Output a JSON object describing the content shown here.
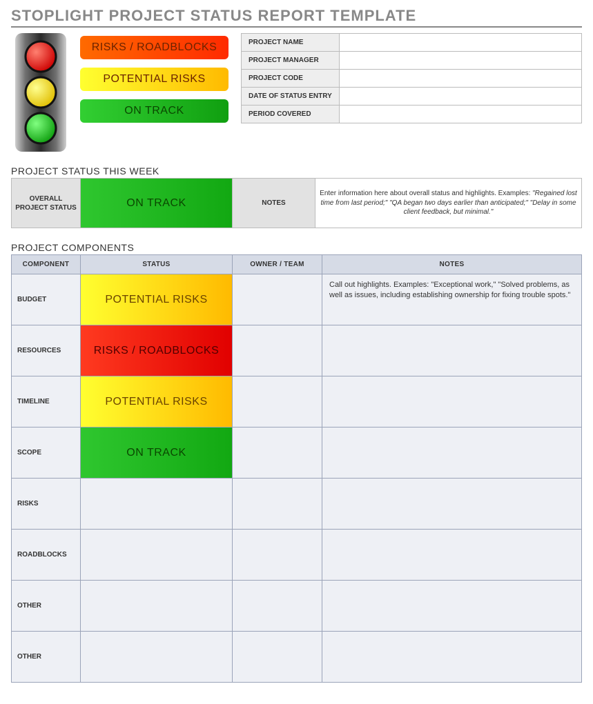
{
  "title": "STOPLIGHT PROJECT STATUS REPORT TEMPLATE",
  "legend": {
    "red": "RISKS / ROADBLOCKS",
    "yellow": "POTENTIAL RISKS",
    "green": "ON TRACK"
  },
  "meta_fields": {
    "project_name": {
      "label": "PROJECT NAME",
      "value": ""
    },
    "project_manager": {
      "label": "PROJECT MANAGER",
      "value": ""
    },
    "project_code": {
      "label": "PROJECT CODE",
      "value": ""
    },
    "date_of_status_entry": {
      "label": "DATE OF STATUS ENTRY",
      "value": ""
    },
    "period_covered": {
      "label": "PERIOD COVERED",
      "value": ""
    }
  },
  "week_section_title": "PROJECT STATUS THIS WEEK",
  "week": {
    "overall_caption": "OVERALL PROJECT STATUS",
    "overall_status_text": "ON TRACK",
    "overall_status_color": "green",
    "notes_caption": "NOTES",
    "notes_lead": "Enter information here about overall status and highlights. Examples: ",
    "notes_examples": "\"Regained lost time from last period;\" \"QA began two days earlier than anticipated;\" \"Delay in some client feedback, but minimal.\""
  },
  "components_section_title": "PROJECT COMPONENTS",
  "components_headers": {
    "component": "COMPONENT",
    "status": "STATUS",
    "owner": "OWNER / TEAM",
    "notes": "NOTES"
  },
  "components": [
    {
      "label": "BUDGET",
      "status_text": "POTENTIAL RISKS",
      "status_color": "yellow",
      "owner": "",
      "note": "Call out highlights. Examples: \"Exceptional work,\" \"Solved problems, as well as issues, including establishing ownership for fixing trouble spots.\""
    },
    {
      "label": "RESOURCES",
      "status_text": "RISKS / ROADBLOCKS",
      "status_color": "red",
      "owner": "",
      "note": ""
    },
    {
      "label": "TIMELINE",
      "status_text": "POTENTIAL RISKS",
      "status_color": "yellow",
      "owner": "",
      "note": ""
    },
    {
      "label": "SCOPE",
      "status_text": "ON TRACK",
      "status_color": "green",
      "owner": "",
      "note": ""
    },
    {
      "label": "RISKS",
      "status_text": "",
      "status_color": "",
      "owner": "",
      "note": ""
    },
    {
      "label": "ROADBLOCKS",
      "status_text": "",
      "status_color": "",
      "owner": "",
      "note": ""
    },
    {
      "label": "OTHER",
      "status_text": "",
      "status_color": "",
      "owner": "",
      "note": ""
    },
    {
      "label": "OTHER",
      "status_text": "",
      "status_color": "",
      "owner": "",
      "note": ""
    }
  ]
}
